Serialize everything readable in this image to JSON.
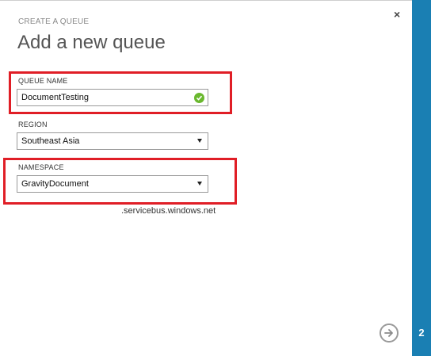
{
  "dialog": {
    "subtitle": "CREATE A QUEUE",
    "title": "Add a new queue",
    "close_label": "×"
  },
  "queue_name": {
    "label": "QUEUE NAME",
    "value": "DocumentTesting",
    "valid_icon": "checkmark-icon"
  },
  "region": {
    "label": "REGION",
    "selected": "Southeast Asia"
  },
  "namespace": {
    "label": "NAMESPACE",
    "selected": "GravityDocument",
    "suffix": ".servicebus.windows.net"
  },
  "navigation": {
    "next_icon": "arrow-right-icon",
    "step": "2"
  },
  "colors": {
    "side_panel": "#1a7fb3",
    "highlight": "#e01e26",
    "valid": "#6ab82e"
  }
}
